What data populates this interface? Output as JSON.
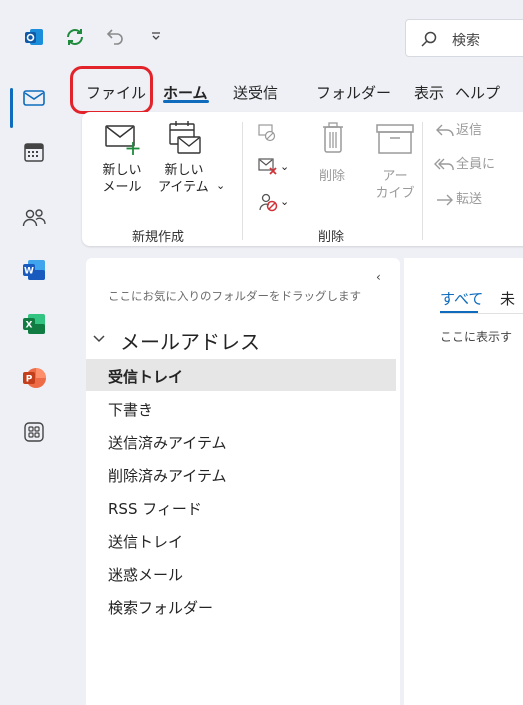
{
  "titlebar": {
    "search_placeholder": "検索",
    "icons": [
      "outlook-logo-icon",
      "sync-icon",
      "undo-icon",
      "qat-dropdown-icon",
      "search-icon"
    ]
  },
  "rail": {
    "items": [
      "mail",
      "calendar",
      "people",
      "word",
      "excel",
      "powerpoint",
      "more-apps"
    ],
    "active": "mail",
    "word_letter": "W",
    "excel_letter": "X",
    "powerpoint_letter": "P"
  },
  "tabs": [
    {
      "label": "ファイル",
      "active": false
    },
    {
      "label": "ホーム",
      "active": true
    },
    {
      "label": "送受信",
      "active": false
    },
    {
      "label": "フォルダー",
      "active": false
    },
    {
      "label": "表示",
      "active": false
    },
    {
      "label": "ヘルプ",
      "active": false
    }
  ],
  "ribbon": {
    "new_group": {
      "label": "新規作成",
      "new_mail_line1": "新しい",
      "new_mail_line2": "メール",
      "new_item_line1": "新しい",
      "new_item_line2": "アイテム",
      "dropdown_glyph": "⌄"
    },
    "delete_group": {
      "label": "削除",
      "delete_label": "削除",
      "archive_line1": "アー",
      "archive_line2": "カイブ"
    },
    "respond_group": {
      "reply": "返信",
      "reply_all": "全員に",
      "forward": "転送"
    }
  },
  "folders": {
    "favorites_hint": "ここにお気に入りのフォルダーをドラッグします",
    "collapse_glyph": "‹",
    "account_name": "メールアドレス",
    "items": [
      {
        "label": "受信トレイ",
        "selected": true
      },
      {
        "label": "下書き",
        "selected": false
      },
      {
        "label": "送信済みアイテム",
        "selected": false
      },
      {
        "label": "削除済みアイテム",
        "selected": false
      },
      {
        "label": "RSS フィード",
        "selected": false
      },
      {
        "label": "送信トレイ",
        "selected": false
      },
      {
        "label": "迷惑メール",
        "selected": false
      },
      {
        "label": "検索フォルダー",
        "selected": false
      }
    ]
  },
  "message_list": {
    "filter_all": "すべて",
    "filter_unread": "未",
    "empty_text": "ここに表示す"
  },
  "colors": {
    "accent": "#0f6cbd",
    "highlight": "#e3232a",
    "background": "#eef0f5"
  }
}
